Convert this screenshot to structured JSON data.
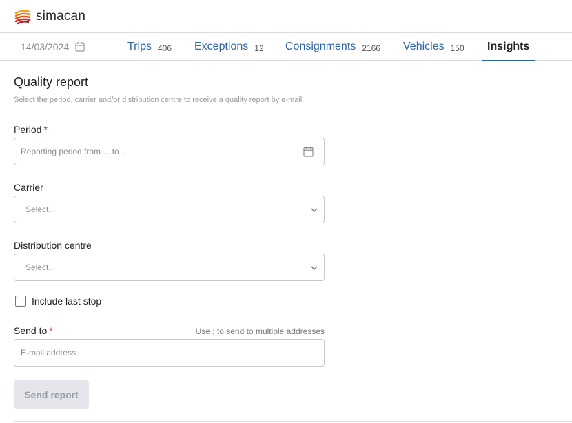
{
  "brand": {
    "name": "simacan"
  },
  "nav": {
    "date": "14/03/2024",
    "tabs": [
      {
        "label": "Trips",
        "count": "406"
      },
      {
        "label": "Exceptions",
        "count": "12"
      },
      {
        "label": "Consignments",
        "count": "2166"
      },
      {
        "label": "Vehicles",
        "count": "150"
      },
      {
        "label": "Insights",
        "count": ""
      }
    ],
    "active_tab": "Insights"
  },
  "form": {
    "title": "Quality report",
    "subtitle": "Select the period, carrier and/or distribution centre to receive a quality report by e-mail.",
    "period_label": "Period",
    "required_mark": "*",
    "period_placeholder": "Reporting period from ... to ...",
    "carrier_label": "Carrier",
    "carrier_placeholder": "Select...",
    "dc_label": "Distribution centre",
    "dc_placeholder": "Select...",
    "include_last_stop_label": "Include last stop",
    "include_last_stop_checked": false,
    "send_to_label": "Send to",
    "send_to_hint": "Use ; to send to multiple addresses",
    "email_placeholder": "E-mail address",
    "send_button": "Send report"
  },
  "colors": {
    "accent": "#2f63a5",
    "required": "#d93232",
    "disabled_button_bg": "#e4e6ec"
  },
  "icons": [
    "simacan-logo-icon",
    "calendar-icon",
    "chevron-down-icon"
  ]
}
